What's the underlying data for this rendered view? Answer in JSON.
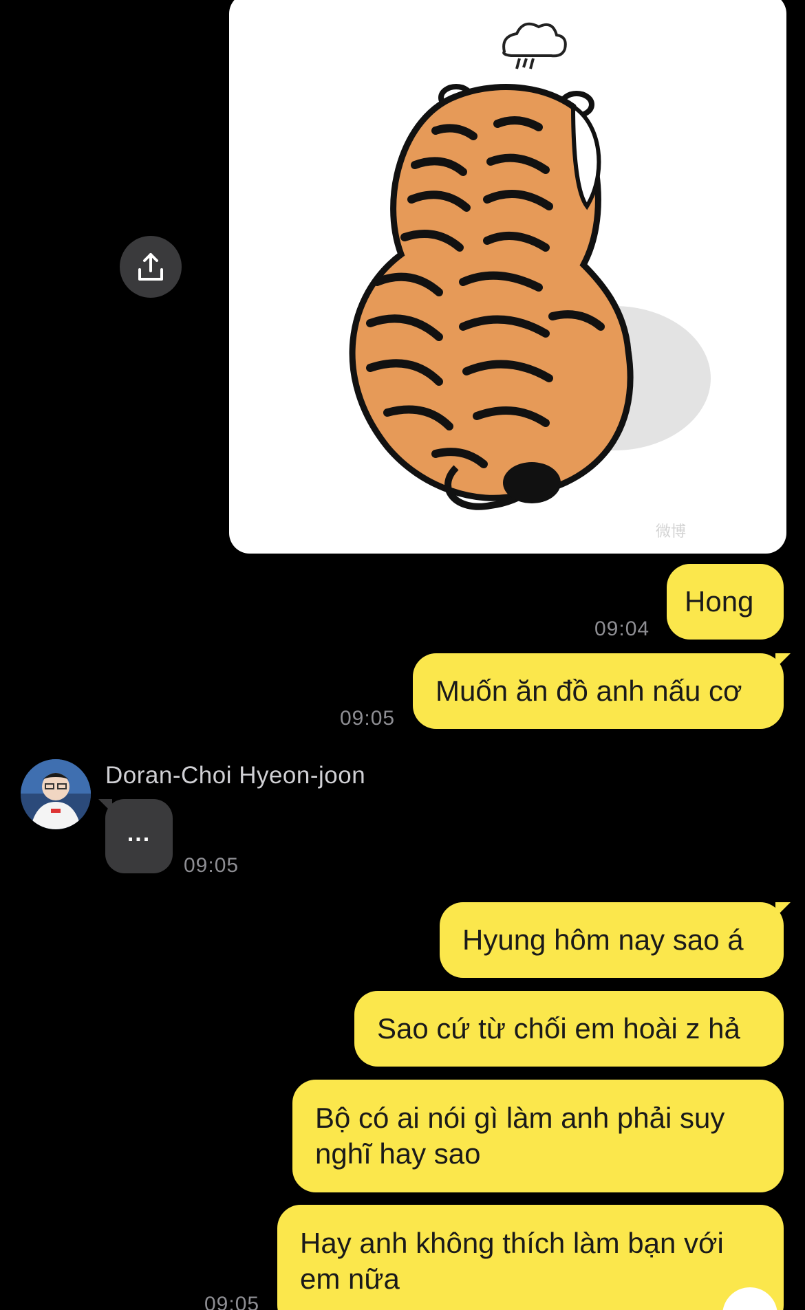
{
  "image_message": {
    "watermark": "微博"
  },
  "share_icon": "share-upload-icon",
  "messages": [
    {
      "text": "Hong",
      "time": "09:04"
    },
    {
      "text": "Muốn ăn đồ anh nấu cơ",
      "time": "09:05"
    }
  ],
  "incoming": {
    "sender": "Doran-Choi Hyeon-joon",
    "typing": "...",
    "time": "09:05"
  },
  "messages2": [
    {
      "text": "Hyung hôm nay sao á"
    },
    {
      "text": "Sao cứ từ chối em hoài z hả"
    },
    {
      "text": "Bộ có ai nói gì làm anh phải suy nghĩ hay sao"
    },
    {
      "text": "Hay anh không thích làm bạn với em nữa",
      "time": "09:05"
    }
  ],
  "colors": {
    "background": "#000000",
    "outgoing_bubble": "#fbe74c",
    "incoming_bubble": "#3a3a3c",
    "timestamp": "#8e8e93"
  }
}
